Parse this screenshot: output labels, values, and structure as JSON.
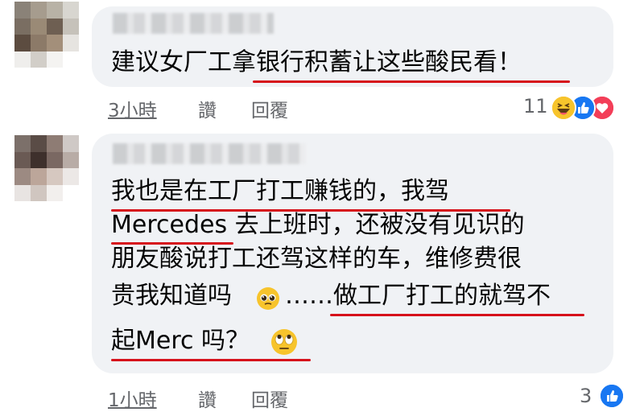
{
  "comments": [
    {
      "text_lines": [
        "建议女厂工拿银行积蓄让这些酸民看！"
      ],
      "time": "3小時",
      "like_label": "讚",
      "reply_label": "回覆",
      "reaction_count": "11",
      "reactions": [
        "haha-icon",
        "like-icon",
        "love-icon"
      ]
    },
    {
      "text_lines": [
        "我也是在工厂打工赚钱的，我驾",
        "Mercedes 去上班时，还被没有见识的",
        "朋友酸说打工还驾这样的车，维修费很",
        "贵我知道吗",
        "……做工厂打工的就驾不",
        "起Merc 吗？"
      ],
      "time": "1小時",
      "like_label": "讚",
      "reply_label": "回覆",
      "reaction_count": "3",
      "reactions": [
        "like-icon"
      ]
    }
  ],
  "colors": {
    "bubble": "#f0f2f5",
    "underline": "#d6111b",
    "meta": "#65676b",
    "like_blue": "#1877f2",
    "love_red": "#f33e58"
  }
}
